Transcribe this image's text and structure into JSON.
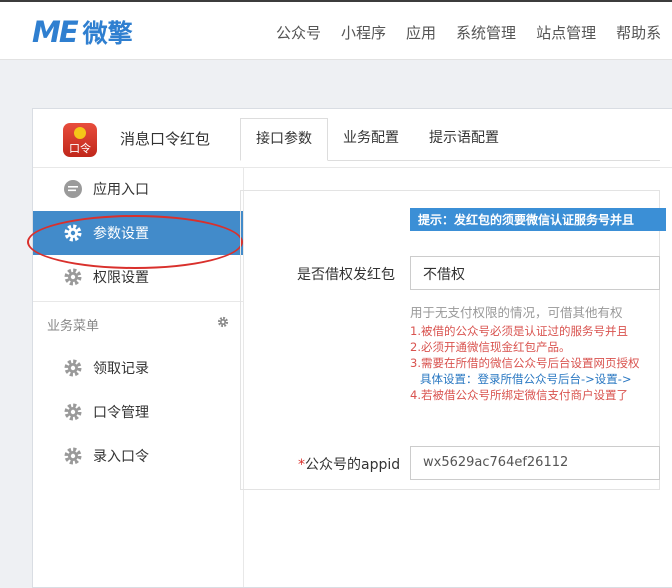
{
  "header": {
    "logo_mark": "ME",
    "logo_text": "微擎",
    "nav": [
      "公众号",
      "小程序",
      "应用",
      "系统管理",
      "站点管理",
      "帮助系"
    ]
  },
  "app": {
    "icon_text": "口令",
    "title": "消息口令红包"
  },
  "sidebar": {
    "items": [
      {
        "label": "应用入口",
        "icon": "comment-icon"
      },
      {
        "label": "参数设置",
        "icon": "gear-icon",
        "active": true
      },
      {
        "label": "权限设置",
        "icon": "gear-icon"
      }
    ],
    "section_title": "业务菜单",
    "sub_items": [
      {
        "label": "领取记录"
      },
      {
        "label": "口令管理"
      },
      {
        "label": "录入口令"
      }
    ]
  },
  "tabs": [
    {
      "label": "接口参数",
      "active": true
    },
    {
      "label": "业务配置"
    },
    {
      "label": "提示语配置"
    }
  ],
  "form": {
    "alert": "提示：发红包的须要微信认证服务号并且",
    "borrow_label": "是否借权发红包",
    "borrow_value": "不借权",
    "help": "用于无支付权限的情况，可借其他有权",
    "notes": [
      "1.被借的公众号必须是认证过的服务号并且",
      "2.必须开通微信现金红包产品。",
      "3.需要在所借的微信公众号后台设置网页授权",
      "具体设置：登录所借公众号后台->设置->",
      "4.若被借公众号所绑定微信支付商户设置了"
    ],
    "appid_required_mark": "*",
    "appid_label": "公众号的appid",
    "appid_value": "wx5629ac764ef26112"
  },
  "colors": {
    "brand": "#2f7fd0",
    "active": "#428bca",
    "highlight_ring": "#d9302c",
    "alert": "#3b8fd6",
    "note_red": "#d9534f"
  }
}
